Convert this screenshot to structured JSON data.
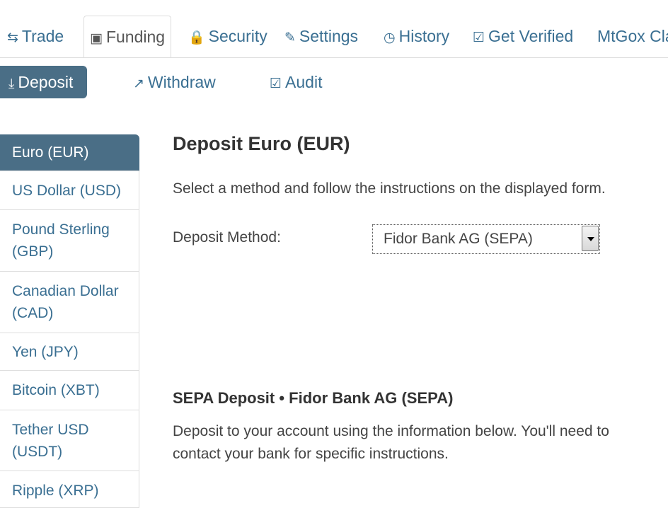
{
  "tabs": [
    {
      "icon": "⇆",
      "label": "Trade"
    },
    {
      "icon": "▣",
      "label": "Funding"
    },
    {
      "icon": "🔒",
      "label": "Security"
    },
    {
      "icon": "✎",
      "label": "Settings"
    },
    {
      "icon": "◷",
      "label": "History"
    },
    {
      "icon": "☑",
      "label": "Get Verified"
    },
    {
      "label": "MtGox Cla"
    }
  ],
  "subnav": [
    {
      "icon": "⤓",
      "label": "Deposit"
    },
    {
      "icon": "↗",
      "label": "Withdraw"
    },
    {
      "icon": "☑",
      "label": "Audit"
    }
  ],
  "sidebar": [
    {
      "label": "Euro (EUR)"
    },
    {
      "label": "US Dollar (USD)"
    },
    {
      "label": "Pound Sterling (GBP)"
    },
    {
      "label": "Canadian Dollar (CAD)"
    },
    {
      "label": "Yen (JPY)"
    },
    {
      "label": "Bitcoin (XBT)"
    },
    {
      "label": "Tether USD (USDT)"
    },
    {
      "label": "Ripple (XRP)"
    }
  ],
  "main": {
    "title": "Deposit Euro (EUR)",
    "intro": "Select a method and follow the instructions on the displayed form.",
    "method_label": "Deposit Method:",
    "method_value": "Fidor Bank AG (SEPA)",
    "section_title": "SEPA Deposit • Fidor Bank AG (SEPA)",
    "section_text": "Deposit to your account using the information below. You'll need to contact your bank for specific instructions."
  },
  "colors": {
    "accent": "#4a6e86",
    "link": "#3a6f92"
  }
}
